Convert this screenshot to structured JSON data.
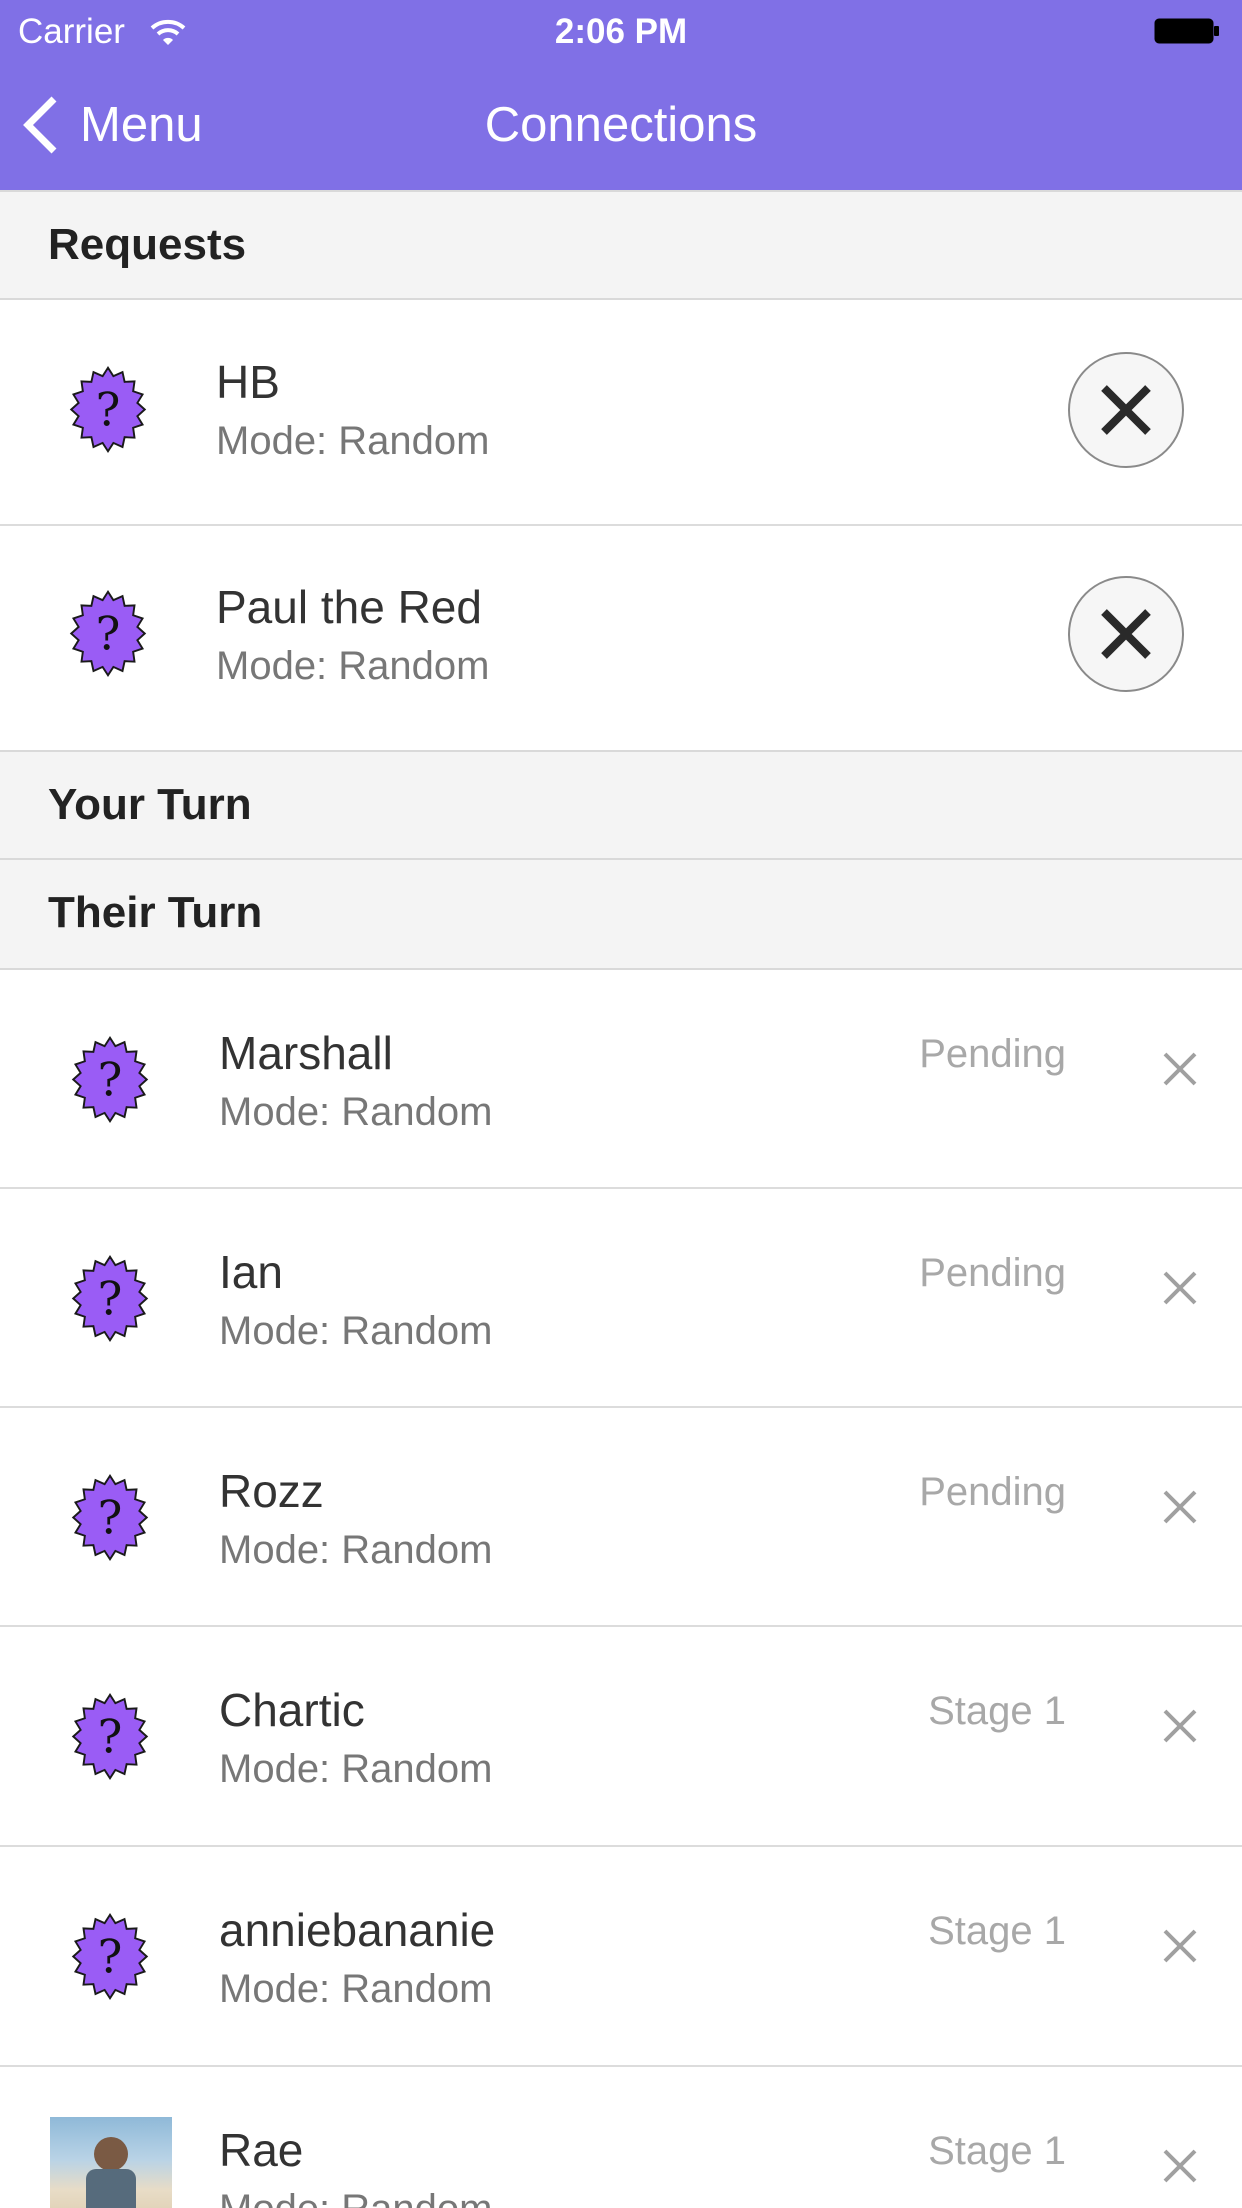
{
  "status_bar": {
    "carrier": "Carrier",
    "time": "2:06 PM"
  },
  "nav": {
    "back_label": "Menu",
    "title": "Connections"
  },
  "sections": {
    "requests": "Requests",
    "your_turn": "Your Turn",
    "their_turn": "Their Turn"
  },
  "requests": [
    {
      "name": "HB",
      "mode": "Mode: Random"
    },
    {
      "name": "Paul the Red",
      "mode": "Mode: Random"
    }
  ],
  "their_turn": [
    {
      "name": "Marshall",
      "mode": "Mode: Random",
      "status": "Pending"
    },
    {
      "name": "Ian",
      "mode": "Mode: Random",
      "status": "Pending"
    },
    {
      "name": "Rozz",
      "mode": "Mode: Random",
      "status": "Pending"
    },
    {
      "name": "Chartic",
      "mode": "Mode: Random",
      "status": "Stage 1"
    },
    {
      "name": "anniebananie",
      "mode": "Mode: Random",
      "status": "Stage 1"
    },
    {
      "name": "Rae",
      "mode": "Mode: Random",
      "status": "Stage 1"
    }
  ],
  "colors": {
    "accent": "#8070E6",
    "badge": "#9A5CF5"
  },
  "icons": {
    "avatar_placeholder": "question-badge-icon",
    "remove": "close-icon",
    "back": "chevron-left-icon"
  }
}
